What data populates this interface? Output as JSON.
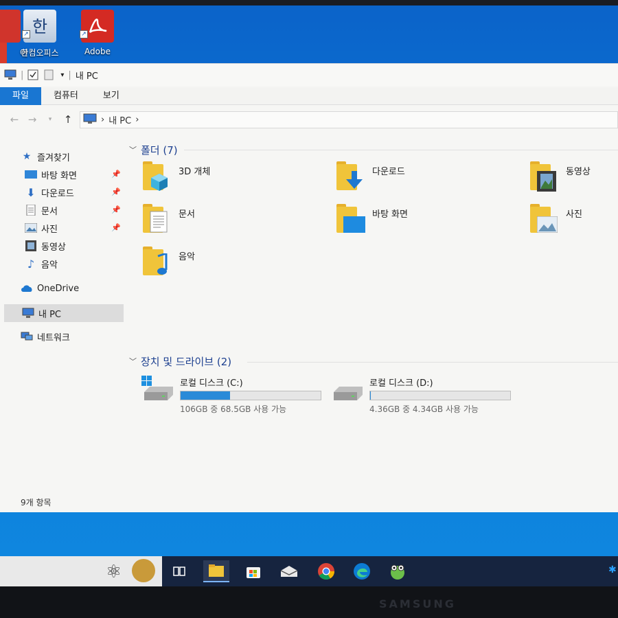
{
  "desktop": {
    "icons": [
      {
        "label": "어",
        "icon": "app-icon"
      },
      {
        "label": "한컴오피스",
        "icon": "hancom-office-icon"
      },
      {
        "label": "Adobe",
        "icon": "adobe-acrobat-icon"
      }
    ]
  },
  "window": {
    "qat_title": "내 PC",
    "ribbon_tabs": [
      "파일",
      "컴퓨터",
      "보기"
    ],
    "address": {
      "path": [
        "내 PC"
      ]
    },
    "nav_pane": {
      "quick_access": "즐겨찾기",
      "items": [
        {
          "label": "바탕 화면",
          "icon": "desktop-icon",
          "pinned": true
        },
        {
          "label": "다운로드",
          "icon": "download-icon",
          "pinned": true
        },
        {
          "label": "문서",
          "icon": "document-icon",
          "pinned": true
        },
        {
          "label": "사진",
          "icon": "picture-icon",
          "pinned": true
        },
        {
          "label": "동영상",
          "icon": "video-icon",
          "pinned": false
        },
        {
          "label": "음악",
          "icon": "music-icon",
          "pinned": false
        }
      ],
      "onedrive": "OneDrive",
      "this_pc": "내 PC",
      "network": "네트워크"
    },
    "folders_group": "폴더 (7)",
    "folders": [
      {
        "name": "3D 개체",
        "icon": "3d-objects-folder-icon"
      },
      {
        "name": "다운로드",
        "icon": "downloads-folder-icon"
      },
      {
        "name": "동영상",
        "icon": "videos-folder-icon"
      },
      {
        "name": "문서",
        "icon": "documents-folder-icon"
      },
      {
        "name": "바탕 화면",
        "icon": "desktop-folder-icon"
      },
      {
        "name": "사진",
        "icon": "pictures-folder-icon"
      },
      {
        "name": "음악",
        "icon": "music-folder-icon"
      }
    ],
    "drives_group": "장치 및 드라이브 (2)",
    "drives": [
      {
        "name": "로컬 디스크 (C:)",
        "usage": "106GB 중 68.5GB 사용 가능",
        "used_fraction": 0.354
      },
      {
        "name": "로컬 디스크 (D:)",
        "usage": "4.36GB 중 4.34GB 사용 가능",
        "used_fraction": 0.005
      }
    ],
    "status": "9개 항목"
  },
  "taskbar": {
    "items": [
      "atom-icon",
      "avatar-icon",
      "task-view-icon",
      "file-explorer-icon",
      "store-icon",
      "mail-icon",
      "chrome-icon",
      "edge-icon",
      "frog-app-icon"
    ]
  },
  "monitor": {
    "brand": "SAMSUNG"
  }
}
